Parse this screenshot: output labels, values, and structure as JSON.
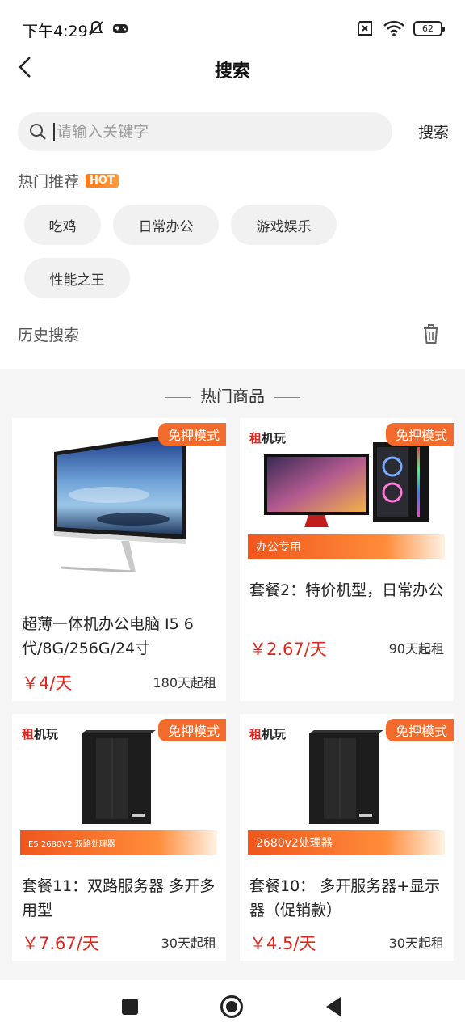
{
  "status": {
    "time": "下午4:29",
    "battery": "62"
  },
  "nav": {
    "title": "搜索"
  },
  "search": {
    "placeholder": "请输入关键字",
    "button": "搜索"
  },
  "hot": {
    "title": "热门推荐",
    "badge": "HOT",
    "tags": [
      "吃鸡",
      "日常办公",
      "游戏娱乐",
      "性能之王"
    ]
  },
  "history": {
    "title": "历史搜索"
  },
  "goods": {
    "header": "热门商品",
    "items": [
      {
        "badge": "免押模式",
        "title": "超薄一体机办公电脑 I5 6代/8G/256G/24寸",
        "price": "￥4/天",
        "min": "180天起租",
        "strip": "",
        "brand": ""
      },
      {
        "badge": "免押模式",
        "title": "套餐2：特价机型，日常办公",
        "price": "￥2.67/天",
        "min": "90天起租",
        "strip": "办公专用",
        "brand": "机玩",
        "brand_zu": "租"
      },
      {
        "badge": "免押模式",
        "title": "套餐11：双路服务器 多开多用型",
        "price": "￥7.67/天",
        "min": "30天起租",
        "strip": "E5 2680V2 双路处理器",
        "brand": "机玩",
        "brand_zu": "租"
      },
      {
        "badge": "免押模式",
        "title": "套餐10： 多开服务器+显示器（促销款）",
        "price": "￥4.5/天",
        "min": "30天起租",
        "strip": "2680v2处理器",
        "brand": "机玩",
        "brand_zu": "租"
      }
    ]
  }
}
